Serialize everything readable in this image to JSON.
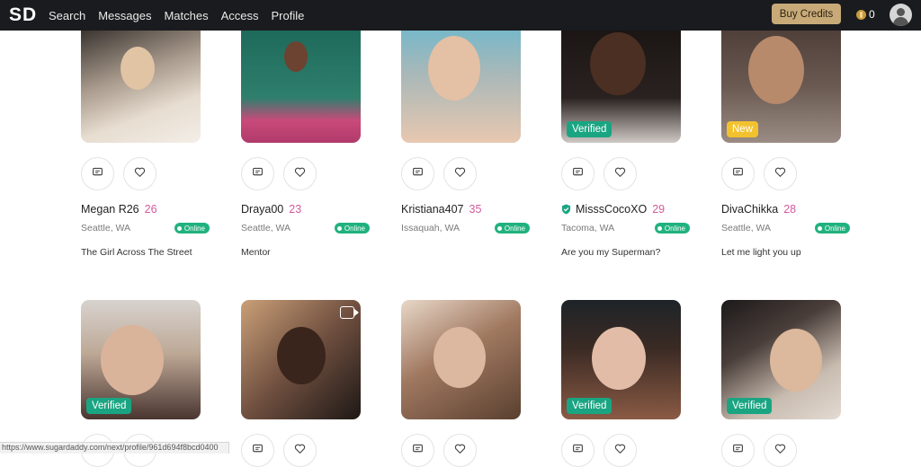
{
  "header": {
    "logo": "SD",
    "nav": [
      "Search",
      "Messages",
      "Matches",
      "Access",
      "Profile"
    ],
    "buy_credits": "Buy Credits",
    "credit_count": "0"
  },
  "profiles_row1": [
    {
      "name": "Megan R26",
      "age": "26",
      "location": "Seattle, WA",
      "online": "Online",
      "tagline": "The Girl Across The Street",
      "verified_icon": false,
      "badge": ""
    },
    {
      "name": "Draya00",
      "age": "23",
      "location": "Seattle, WA",
      "online": "Online",
      "tagline": "Mentor",
      "verified_icon": false,
      "badge": ""
    },
    {
      "name": "Kristiana407",
      "age": "35",
      "location": "Issaquah, WA",
      "online": "Online",
      "tagline": "",
      "verified_icon": false,
      "badge": ""
    },
    {
      "name": "MisssCocoXO",
      "age": "29",
      "location": "Tacoma, WA",
      "online": "Online",
      "tagline": "Are you my Superman?",
      "verified_icon": true,
      "badge": "Verified"
    },
    {
      "name": "DivaChikka",
      "age": "28",
      "location": "Seattle, WA",
      "online": "Online",
      "tagline": "Let me light you up",
      "verified_icon": false,
      "badge": "New"
    }
  ],
  "profiles_row2": [
    {
      "badge": "Verified",
      "video": false
    },
    {
      "badge": "",
      "video": true
    },
    {
      "badge": "",
      "video": false
    },
    {
      "badge": "Verified",
      "video": false
    },
    {
      "badge": "Verified",
      "video": false
    }
  ],
  "status_bar_url": "https://www.sugardaddy.com/next/profile/961d694f8bcd0400",
  "icons": {
    "message": "message-icon",
    "favorite": "heart-icon",
    "verified": "shield-check-icon",
    "video": "video-camera-icon",
    "coin": "coin-icon",
    "account": "user-icon"
  },
  "colors": {
    "topbar": "#1a1b1e",
    "buy_button": "#c8aa78",
    "verified_badge": "#1aa582",
    "new_badge": "#f2c12e",
    "online": "#20b27d",
    "age": "#d45a9a"
  }
}
